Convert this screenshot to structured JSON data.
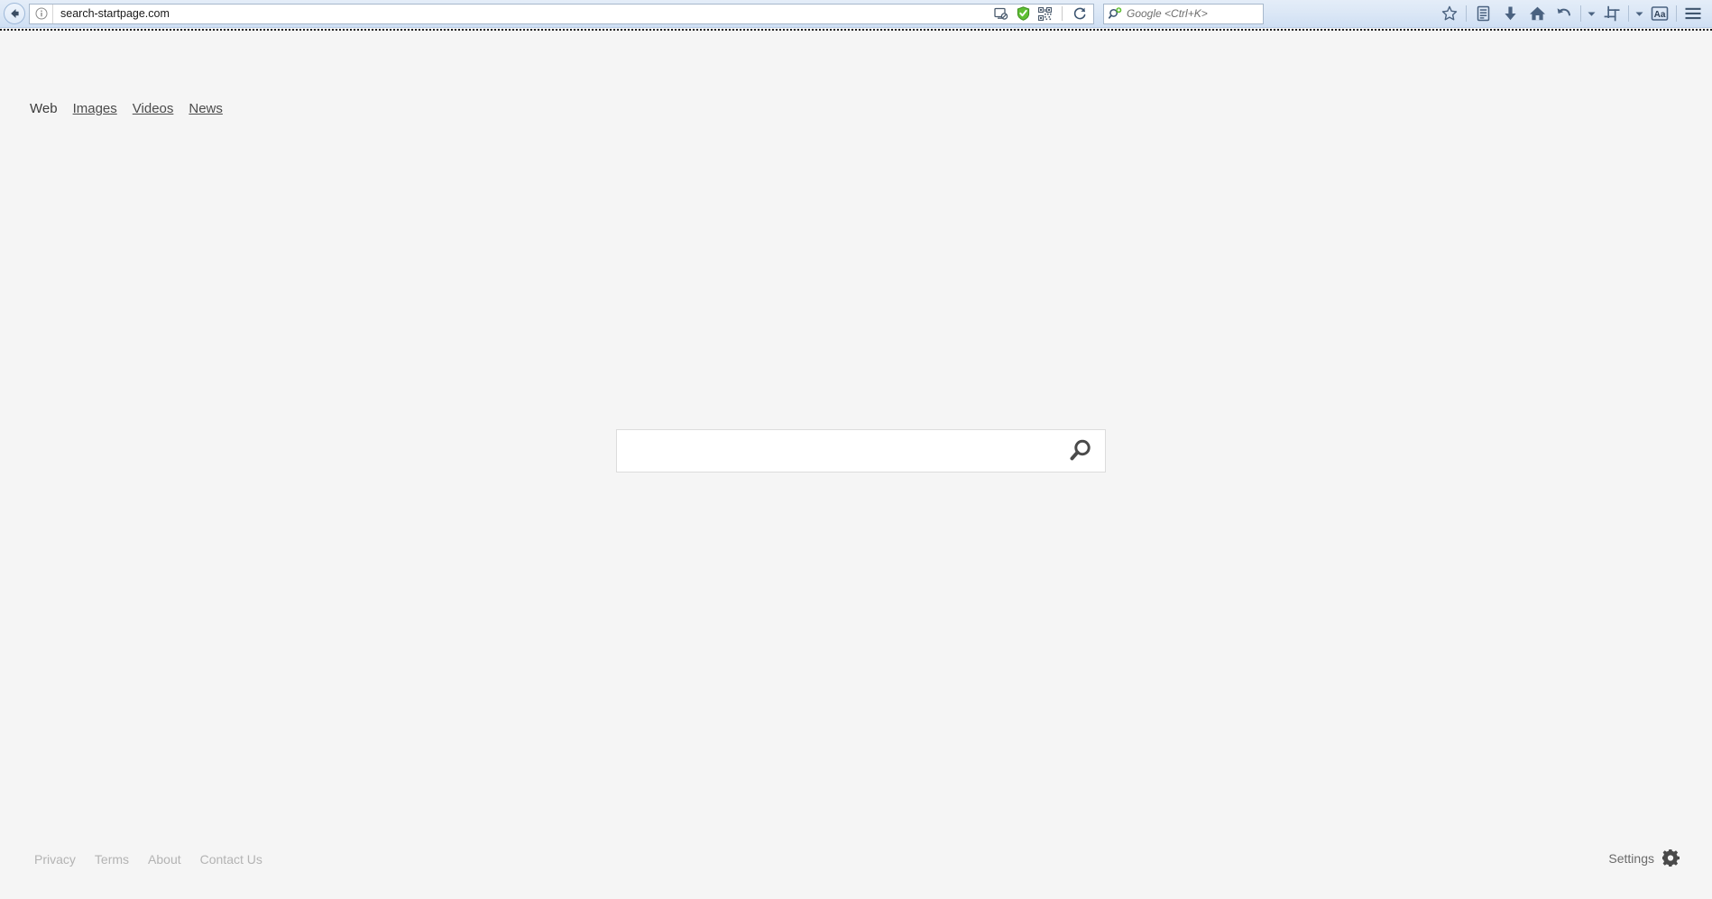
{
  "browser": {
    "back_button": "back-arrow-icon",
    "url": "search-startpage.com",
    "url_info_icon": "info-icon",
    "url_bar_icons": [
      {
        "name": "block-content-icon",
        "label": "Block content"
      },
      {
        "name": "shield-icon",
        "label": "Security shield",
        "color": "#5fbf33"
      },
      {
        "name": "qr-code-icon",
        "label": "QR code"
      },
      {
        "name": "reload-icon",
        "label": "Reload"
      }
    ],
    "search_field": {
      "engine_icon": "search-add-icon",
      "placeholder": "Google <Ctrl+K>",
      "value": ""
    },
    "right_icons": [
      {
        "name": "star-icon",
        "label": "Bookmark"
      },
      {
        "name": "library-icon",
        "label": "Library"
      },
      {
        "name": "download-icon",
        "label": "Downloads"
      },
      {
        "name": "home-icon",
        "label": "Home"
      },
      {
        "name": "undo-icon",
        "label": "Undo"
      },
      {
        "name": "chevron-down-icon",
        "label": "More"
      },
      {
        "name": "crop-icon",
        "label": "Screenshot"
      },
      {
        "name": "chevron-down-icon",
        "label": "More"
      },
      {
        "name": "text-size-icon",
        "label": "Aa"
      },
      {
        "name": "hamburger-menu-icon",
        "label": "Menu"
      }
    ],
    "text_size_label": "Aa"
  },
  "page": {
    "nav_tabs": [
      {
        "label": "Web",
        "active": true
      },
      {
        "label": "Images",
        "active": false
      },
      {
        "label": "Videos",
        "active": false
      },
      {
        "label": "News",
        "active": false
      }
    ],
    "search": {
      "value": "",
      "placeholder": "",
      "button_icon": "magnifier-icon"
    },
    "footer_links": [
      "Privacy",
      "Terms",
      "About",
      "Contact Us"
    ],
    "settings": {
      "label": "Settings",
      "icon": "gear-icon"
    }
  },
  "colors": {
    "page_background": "#f5f5f5",
    "toolbar_background": "#dbe7f6",
    "search_box_border": "#dcdcdc",
    "footer_link": "#b3b3b3",
    "shield_green": "#5fbf33"
  }
}
